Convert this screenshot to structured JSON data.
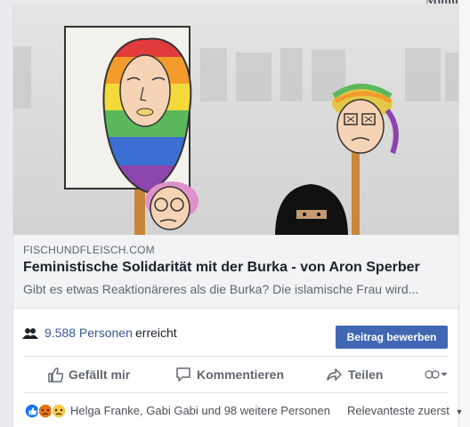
{
  "top_corner_text": "Mono",
  "link_preview": {
    "domain": "FISCHUNDFLEISCH.COM",
    "title": "Feministische Solidarität mit der Burka - von Aron Sperber",
    "description": "Gibt es etwas Reaktionäreres als die Burka? Die islamische Frau wird..."
  },
  "reach": {
    "count": "9.588 Personen",
    "suffix": "erreicht",
    "boost_label": "Beitrag bewerben"
  },
  "actions": {
    "like": "Gefällt mir",
    "comment": "Kommentieren",
    "share": "Teilen"
  },
  "reactions": {
    "names": "Helga Franke, Gabi Gabi und 98 weitere Personen",
    "sort_label": "Relevanteste zuerst"
  },
  "colors": {
    "link_blue": "#385898",
    "button_blue": "#4267b2",
    "muted": "#606770"
  }
}
